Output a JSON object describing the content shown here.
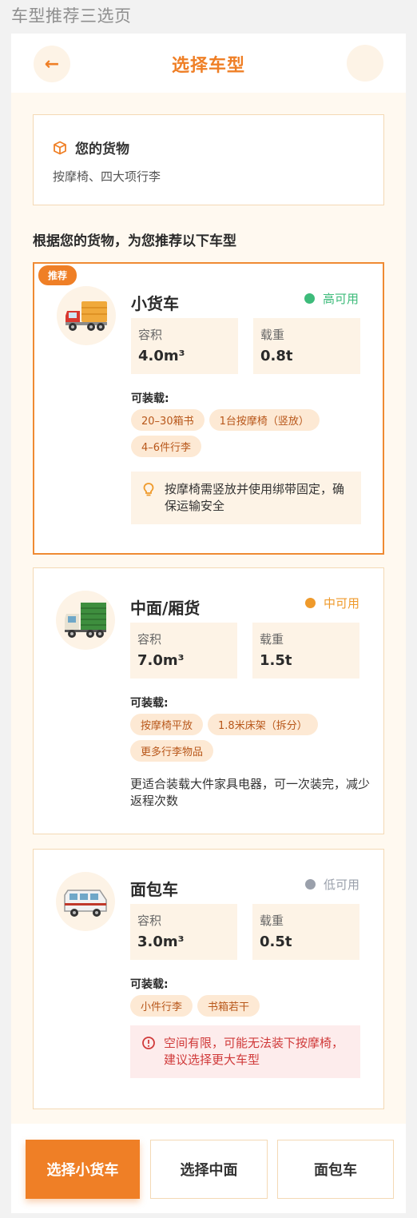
{
  "page_label": "车型推荐三选页",
  "header": {
    "title": "选择车型",
    "back_icon": "←"
  },
  "cargo": {
    "title": "您的货物",
    "description": "按摩椅、四大项行李"
  },
  "section_title": "根据您的货物，为您推荐以下车型",
  "common": {
    "volume_label": "容积",
    "load_label": "载重",
    "can_load_label": "可装载:"
  },
  "vehicles": [
    {
      "badge": "推荐",
      "name": "小货车",
      "availability": "高可用",
      "availability_color": "#3dbb7a",
      "volume": "4.0m³",
      "load": "0.8t",
      "tags": [
        "20–30箱书",
        "1台按摩椅（竖放）",
        "4–6件行李"
      ],
      "tip": "按摩椅需竖放并使用绑带固定，确保运输安全",
      "tip_type": "warn"
    },
    {
      "name": "中面/厢货",
      "availability": "中可用",
      "availability_color": "#ef9a2b",
      "volume": "7.0m³",
      "load": "1.5t",
      "tags": [
        "按摩椅平放",
        "1.8米床架（拆分）",
        "更多行李物品"
      ],
      "note": "更适合装载大件家具电器，可一次装完，减少返程次数"
    },
    {
      "name": "面包车",
      "availability": "低可用",
      "availability_color": "#9aa0ab",
      "volume": "3.0m³",
      "load": "0.5t",
      "tags": [
        "小件行李",
        "书箱若干"
      ],
      "tip": "空间有限，可能无法装下按摩椅，建议选择更大车型",
      "tip_type": "err"
    }
  ],
  "bottom": {
    "primary": "选择小货车",
    "second": "选择中面",
    "third": "面包车"
  }
}
